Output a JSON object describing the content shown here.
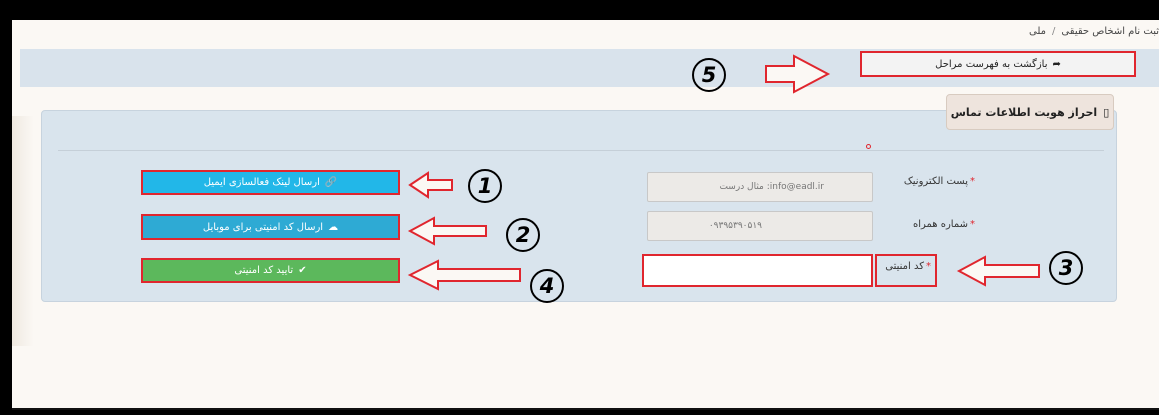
{
  "breadcrumb": {
    "current": "ثبت نام اشخاص حقیقی",
    "separator": "/",
    "parent_partial": "ملی"
  },
  "back_button": {
    "label": "بازگشت به فهرست مراحل",
    "icon": "share-arrow-icon"
  },
  "panel": {
    "title": "احراز هویت اطلاعات تماس",
    "icon": "mobile-phone-icon"
  },
  "form": {
    "email": {
      "label": "پست الکترونیک",
      "required_mark": "*",
      "placeholder": "مثال درست :info@eadl.ir"
    },
    "phone": {
      "label": "شماره همراه",
      "required_mark": "*",
      "value": "۰۹۳۹۵۳۹۰۵۱۹"
    },
    "code": {
      "label": "کد امنیتی",
      "required_mark": "*",
      "value": ""
    }
  },
  "buttons": {
    "send_email_link": {
      "label": "ارسال لینک فعالسازی ایمیل",
      "icon": "link-icon"
    },
    "send_mobile_code": {
      "label": "ارسال کد امنیتی برای موبایل",
      "icon": "cloud-upload-icon"
    },
    "confirm_code": {
      "label": "تایید کد امنیتی",
      "icon": "check-icon"
    }
  },
  "annotations": {
    "n1": "1",
    "n2": "2",
    "n3": "3",
    "n4": "4",
    "n5": "5"
  },
  "colors": {
    "highlight": "#e0262e",
    "cyan": "#22b7e8",
    "green": "#5cb85c",
    "panel": "#d9e4ed"
  }
}
